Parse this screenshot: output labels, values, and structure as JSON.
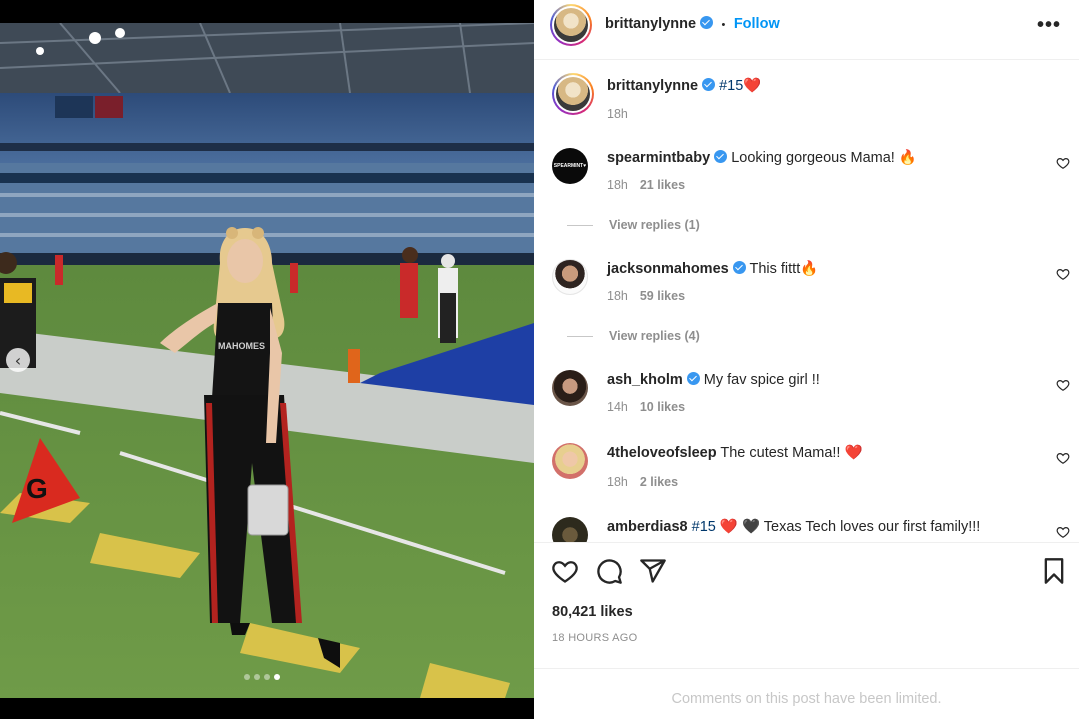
{
  "post": {
    "author": "brittanylynne",
    "follow_label": "Follow",
    "separator": "•",
    "more_label": "•••",
    "caption": {
      "hashtag": "#15",
      "emoji": "❤️",
      "time": "18h"
    },
    "carousel": {
      "prev_label": "‹",
      "slide_count": 4,
      "active_index": 4
    },
    "likes_text": "80,421 likes",
    "time_ago": "18 HOURS AGO",
    "comments_limited": "Comments on this post have been limited."
  },
  "comments": [
    {
      "username": "spearmintbaby",
      "verified": true,
      "text": "Looking gorgeous Mama! 🔥",
      "time": "18h",
      "likes": "21 likes",
      "replies": "View replies (1)"
    },
    {
      "username": "jacksonmahomes",
      "verified": true,
      "text": "This fittt🔥",
      "time": "18h",
      "likes": "59 likes",
      "replies": "View replies (4)"
    },
    {
      "username": "ash_kholm",
      "verified": true,
      "text": "My fav spice girl !!",
      "time": "14h",
      "likes": "10 likes"
    },
    {
      "username": "4theloveofsleep",
      "verified": false,
      "text": "The cutest Mama!! ❤️",
      "time": "18h",
      "likes": "2 likes"
    },
    {
      "username": "amberdias8",
      "verified": false,
      "hashtag": "#15",
      "text": "❤️ 🖤 Texas Tech loves our first family!!!"
    }
  ],
  "avatar_labels": {
    "spearmintbaby": "SPEARMINT♥"
  },
  "colors": {
    "accent": "#0095f6",
    "verified": "#3897f0",
    "heart_red": "#ed4956",
    "meta_gray": "#8e8e8e"
  }
}
